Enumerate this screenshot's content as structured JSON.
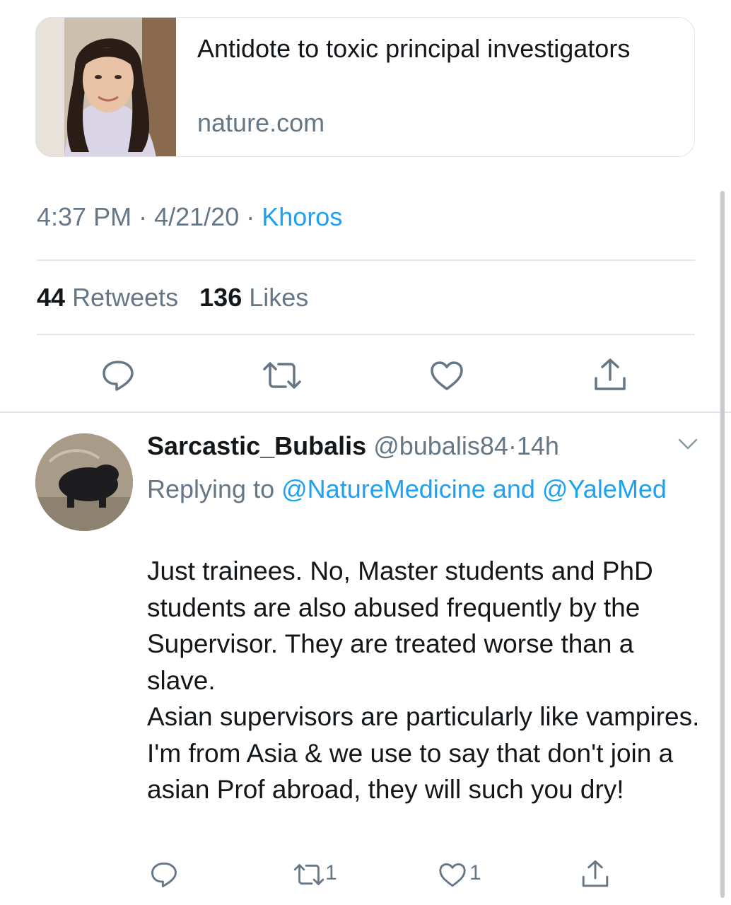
{
  "link_card": {
    "title": "Antidote to toxic principal investigators",
    "domain": "nature.com",
    "image": "portrait-photo"
  },
  "tweet_meta": {
    "time": "4:37 PM",
    "date": "4/21/20",
    "source": "Khoros",
    "separator": "·"
  },
  "stats": {
    "retweets_count": "44",
    "retweets_label": "Retweets",
    "likes_count": "136",
    "likes_label": "Likes"
  },
  "actions": {
    "icons": [
      "reply-icon",
      "retweet-icon",
      "like-icon",
      "share-icon"
    ]
  },
  "reply": {
    "display_name": "Sarcastic_Bubalis",
    "handle": "@bubalis84",
    "time_ago": "14h",
    "replying_prefix": "Replying to",
    "mention_1": "@NatureMedicine",
    "conjunction": "and",
    "mention_2": "@YaleMed",
    "paragraph_1": "Just trainees. No, Master students and PhD students are also abused frequently by the Supervisor. They are treated worse than a slave.",
    "paragraph_2": "Asian supervisors are particularly like vampires. I'm from Asia & we use to say that don't join a asian Prof abroad, they will such you dry!",
    "retweet_count": "1",
    "like_count": "1"
  },
  "colors": {
    "accent": "#1da1f2",
    "secondary_text": "#657786",
    "primary_text": "#14171a",
    "divider": "#e1e8ed"
  }
}
